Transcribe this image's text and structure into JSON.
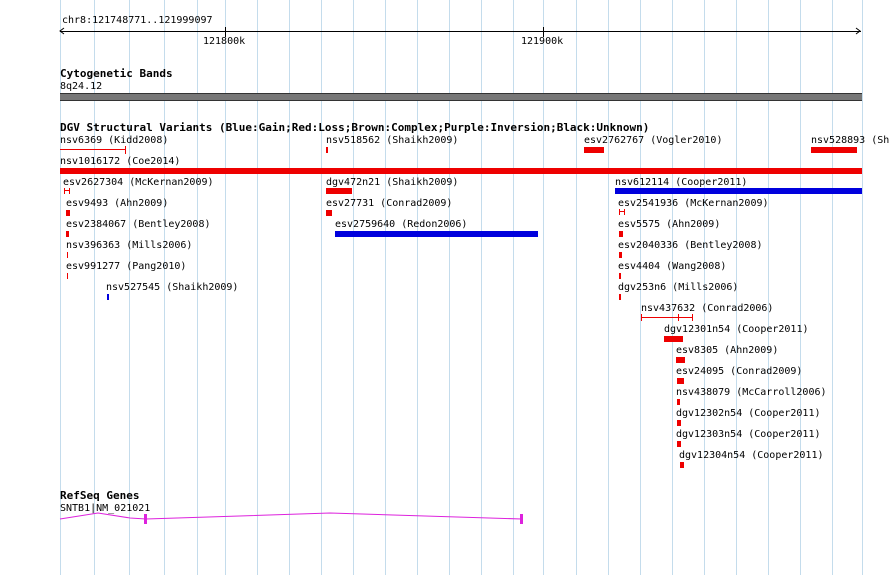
{
  "ruler": {
    "location": "chr8:121748771..121999097",
    "ticks": [
      "121800k",
      "121900k"
    ]
  },
  "tracks": {
    "cytoband": {
      "title": "Cytogenetic Bands",
      "band": "8q24.12"
    },
    "dgv": {
      "title": "DGV Structural Variants (Blue:Gain;Red:Loss;Brown:Complex;Purple:Inversion;Black:Unknown)",
      "features": [
        "nsv6369 (Kidd2008)",
        "nsv518562 (Shaikh2009)",
        "esv2762767 (Vogler2010)",
        "nsv528893 (Sh",
        "nsv1016172 (Coe2014)",
        "esv2627304 (McKernan2009)",
        "dgv472n21 (Shaikh2009)",
        "nsv612114 (Cooper2011)",
        "esv9493 (Ahn2009)",
        "esv27731 (Conrad2009)",
        "esv2541936 (McKernan2009)",
        "esv2384067 (Bentley2008)",
        "esv2759640 (Redon2006)",
        "esv5575 (Ahn2009)",
        "nsv396363 (Mills2006)",
        "esv2040336 (Bentley2008)",
        "esv991277 (Pang2010)",
        "esv4404 (Wang2008)",
        "nsv527545 (Shaikh2009)",
        "dgv253n6 (Mills2006)",
        "nsv437632 (Conrad2006)",
        "dgv12301n54 (Cooper2011)",
        "esv8305 (Ahn2009)",
        "esv24095 (Conrad2009)",
        "nsv438079 (McCarroll2006)",
        "dgv12302n54 (Cooper2011)",
        "dgv12303n54 (Cooper2011)",
        "dgv12304n54 (Cooper2011)"
      ]
    },
    "refseq": {
      "title": "RefSeq Genes",
      "gene": "SNTB1|NM_021021"
    }
  },
  "colors": {
    "gain": "#0000dd",
    "loss": "#ee0000",
    "gene": "#dd22dd",
    "grid": "#c4dcec",
    "band": "#777777"
  }
}
